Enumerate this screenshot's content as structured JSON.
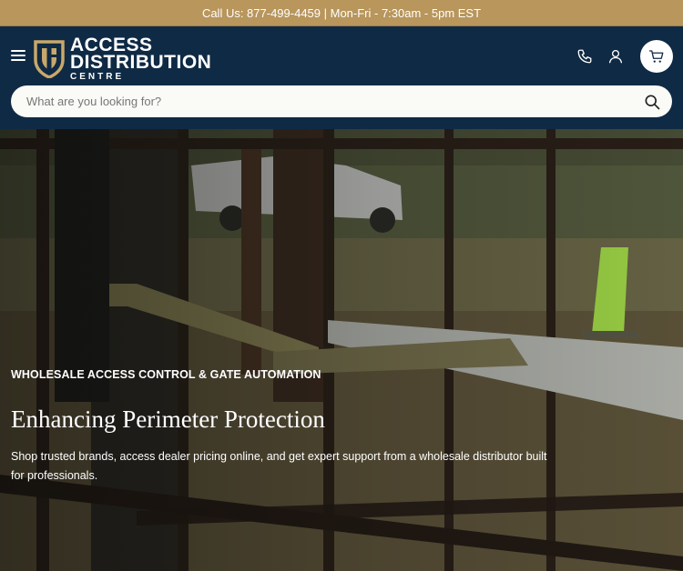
{
  "announcement": {
    "text": "Call Us: 877-499-4459 | Mon-Fri - 7:30am - 5pm EST"
  },
  "header": {
    "logo": {
      "line1": "ACCESS",
      "line2": "DISTRIBUTION",
      "line3": "CENTRE"
    },
    "icons": {
      "menu": "hamburger-menu-icon",
      "phone": "phone-icon",
      "account": "user-icon",
      "cart": "cart-icon"
    }
  },
  "search": {
    "placeholder": "What are you looking for?",
    "icon": "search-icon"
  },
  "hero": {
    "eyebrow": "WHOLESALE ACCESS CONTROL & GATE AUTOMATION",
    "title": "Enhancing Perimeter Protection",
    "subtitle": "Shop trusted brands, access dealer pricing online, and get expert support from a wholesale distributor built for professionals."
  },
  "colors": {
    "navy": "#0f2a44",
    "gold": "#b8965c",
    "white": "#ffffff"
  }
}
